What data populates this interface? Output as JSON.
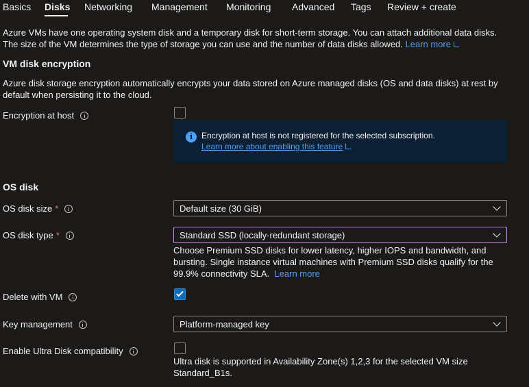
{
  "tabs": [
    {
      "label": "Basics"
    },
    {
      "label": "Disks"
    },
    {
      "label": "Networking"
    },
    {
      "label": "Management"
    },
    {
      "label": "Monitoring"
    },
    {
      "label": "Advanced"
    },
    {
      "label": "Tags"
    },
    {
      "label": "Review + create"
    }
  ],
  "active_tab": "Disks",
  "intro": {
    "line1": "Azure VMs have one operating system disk and a temporary disk for short-term storage. You can attach additional data disks.",
    "line2": "The size of the VM determines the type of storage you can use and the number of data disks allowed.",
    "learn_more": "Learn more"
  },
  "encryption": {
    "heading": "VM disk encryption",
    "desc_line1": "Azure disk storage encryption automatically encrypts your data stored on Azure managed disks (OS and data disks) at rest by",
    "desc_line2": "default when persisting it to the cloud.",
    "at_host_label": "Encryption at host",
    "at_host_checked": false,
    "banner_message": "Encryption at host is not registered for the selected subscription.",
    "banner_link": "Learn more about enabling this feature"
  },
  "os_disk": {
    "heading": "OS disk",
    "size_label": "OS disk size",
    "size_value": "Default size (30 GiB)",
    "type_label": "OS disk type",
    "type_value": "Standard SSD (locally-redundant storage)",
    "type_help_line1": "Choose Premium SSD disks for lower latency, higher IOPS and bandwidth, and",
    "type_help_line2": "bursting. Single instance virtual machines with Premium SSD disks qualify for the",
    "type_help_line3": "99.9% connectivity SLA.",
    "type_help_link": "Learn more",
    "required_mark": "*",
    "delete_label": "Delete with VM",
    "delete_checked": true,
    "key_label": "Key management",
    "key_value": "Platform-managed key",
    "ultra_label": "Enable Ultra Disk compatibility",
    "ultra_checked": false,
    "ultra_help_line1": "Ultra disk is supported in Availability Zone(s) 1,2,3 for the selected VM size",
    "ultra_help_line2": "Standard_B1s."
  },
  "icons": {
    "info": "info-circle-icon",
    "external": "external-link-icon",
    "chevron": "chevron-down-icon",
    "check": "checkmark-icon",
    "banner": "info-filled-icon"
  },
  "colors": {
    "background": "#1b1a19",
    "link": "#4f9ffa",
    "banner": "#0b2034",
    "checked": "#0f6cbd",
    "required": "#f1707b",
    "focus_border": "#c891e8"
  }
}
